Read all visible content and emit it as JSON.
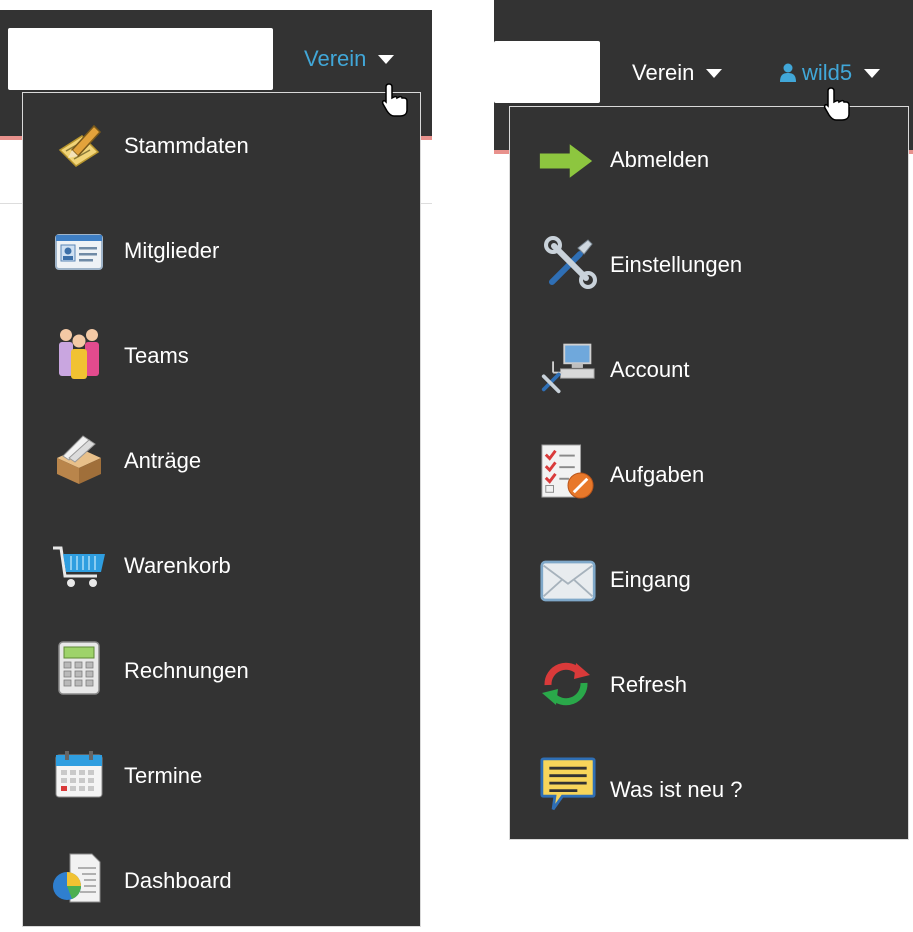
{
  "left": {
    "nav": {
      "label": "Verein"
    },
    "menu_items": [
      {
        "label": "Stammdaten",
        "icon": "edit-notes-icon"
      },
      {
        "label": "Mitglieder",
        "icon": "id-card-icon"
      },
      {
        "label": "Teams",
        "icon": "people-group-icon"
      },
      {
        "label": "Anträge",
        "icon": "filing-box-icon"
      },
      {
        "label": "Warenkorb",
        "icon": "shopping-cart-icon"
      },
      {
        "label": "Rechnungen",
        "icon": "calculator-icon"
      },
      {
        "label": "Termine",
        "icon": "calendar-icon"
      },
      {
        "label": "Dashboard",
        "icon": "pie-chart-icon"
      }
    ]
  },
  "right": {
    "nav": {
      "verein_label": "Verein",
      "user_label": "wild5"
    },
    "menu_items": [
      {
        "label": "Abmelden",
        "icon": "arrow-right-icon"
      },
      {
        "label": "Einstellungen",
        "icon": "tools-icon"
      },
      {
        "label": "Account",
        "icon": "network-computer-icon"
      },
      {
        "label": "Aufgaben",
        "icon": "checklist-icon"
      },
      {
        "label": "Eingang",
        "icon": "envelope-icon"
      },
      {
        "label": "Refresh",
        "icon": "refresh-icon"
      },
      {
        "label": "Was ist neu ?",
        "icon": "speech-bubble-icon"
      }
    ]
  },
  "colors": {
    "menu_bg": "#333333",
    "link_blue": "#41a7d8",
    "accent_red": "#e8918c"
  }
}
